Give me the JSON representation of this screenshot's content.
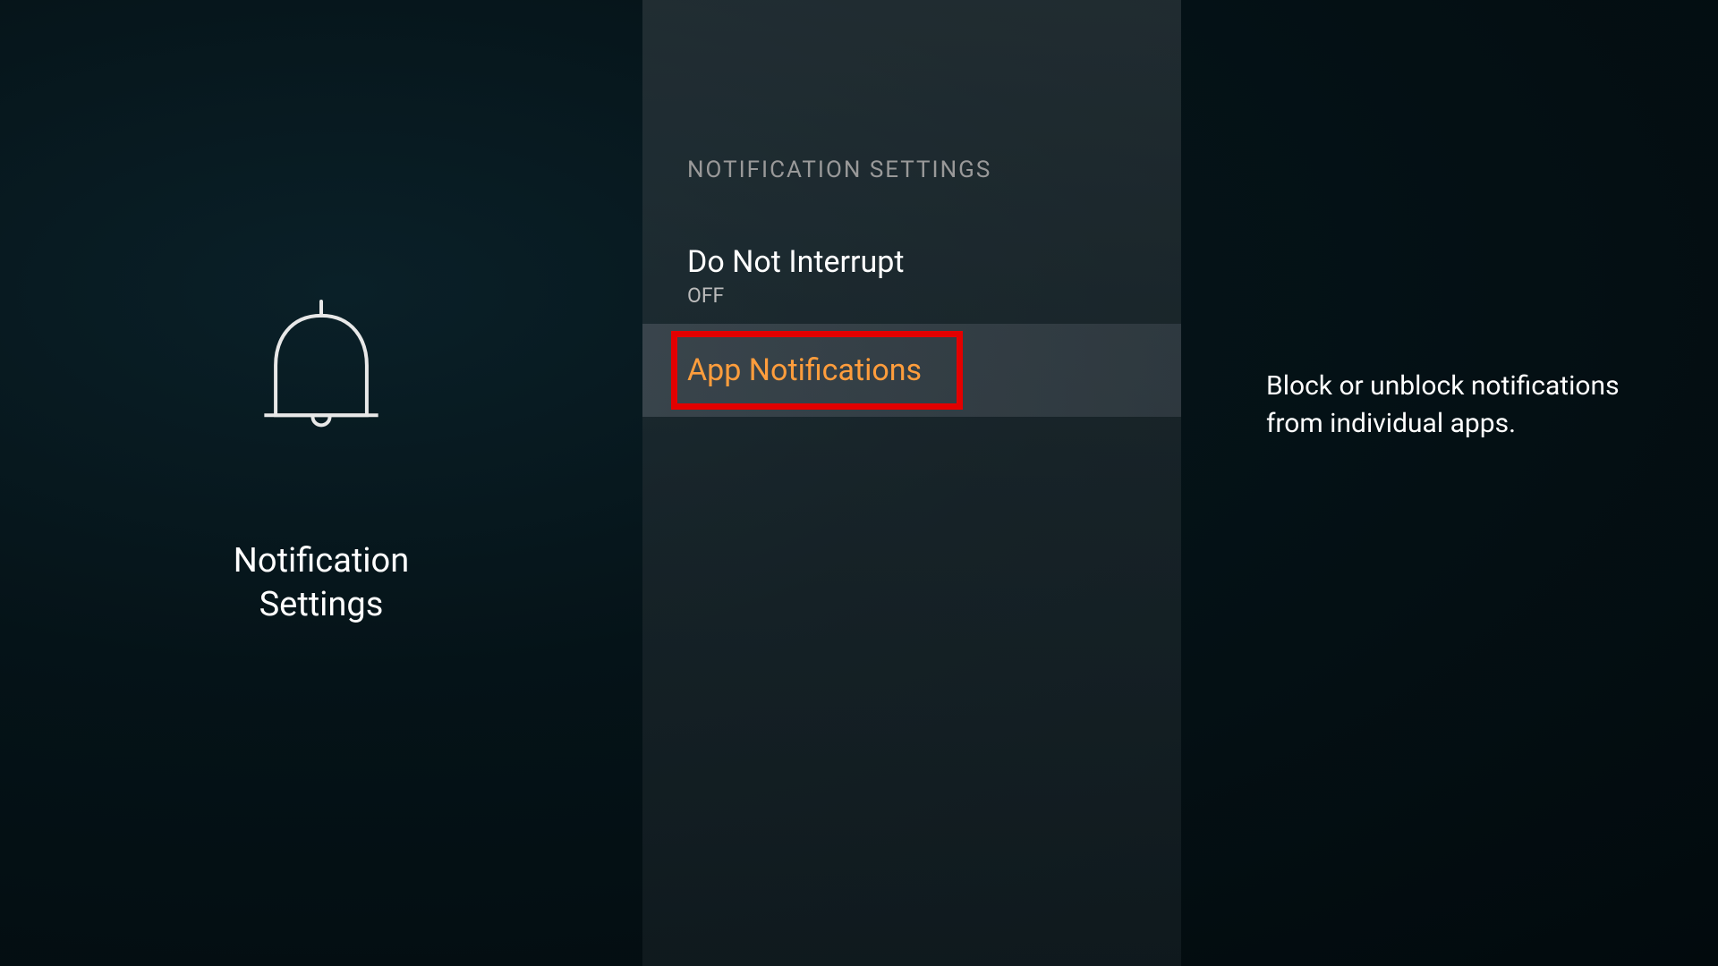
{
  "page": {
    "title": "Notification\nSettings",
    "title_line1": "Notification",
    "title_line2": "Settings"
  },
  "section": {
    "header": "NOTIFICATION SETTINGS"
  },
  "menu": {
    "items": [
      {
        "title": "Do Not Interrupt",
        "subtitle": "OFF",
        "selected": false
      },
      {
        "title": "App Notifications",
        "subtitle": "",
        "selected": true
      }
    ]
  },
  "description": {
    "text": "Block or unblock notifications from individual apps."
  },
  "colors": {
    "accent": "#ff9d3c",
    "highlight_box": "#e30000"
  }
}
